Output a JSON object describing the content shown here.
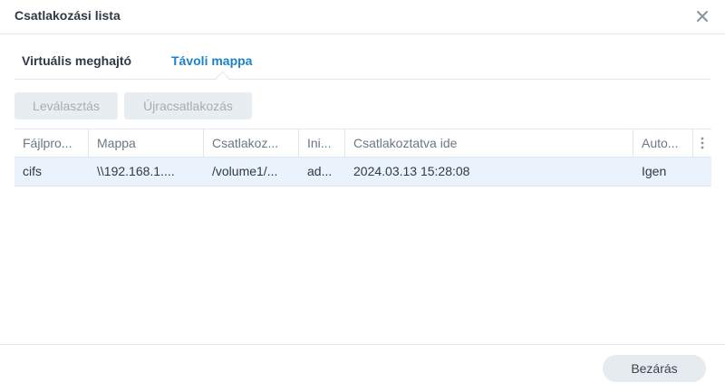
{
  "dialog": {
    "title": "Csatlakozási lista",
    "close_icon": "close-icon"
  },
  "tabs": [
    {
      "label": "Virtuális meghajtó",
      "active": false
    },
    {
      "label": "Távoli mappa",
      "active": true
    }
  ],
  "toolbar": {
    "disconnect_label": "Leválasztás",
    "reconnect_label": "Újracsatlakozás"
  },
  "table": {
    "columns": [
      "Fájlpro...",
      "Mappa",
      "Csatlakoz...",
      "Ini...",
      "Csatlakoztatva ide",
      "Auto..."
    ],
    "column_menu_icon": "vertical-dots-icon",
    "rows": [
      {
        "protocol": "cifs",
        "folder": "\\\\192.168.1....",
        "mount_path": "/volume1/...",
        "initiator": "ad...",
        "connected_at": "2024.03.13 15:28:08",
        "auto": "Igen"
      }
    ]
  },
  "footer": {
    "close_label": "Bezárás"
  },
  "colors": {
    "accent": "#1e82c7",
    "selected_row": "#eaf3fb",
    "disabled_button": "#e8edf2"
  }
}
